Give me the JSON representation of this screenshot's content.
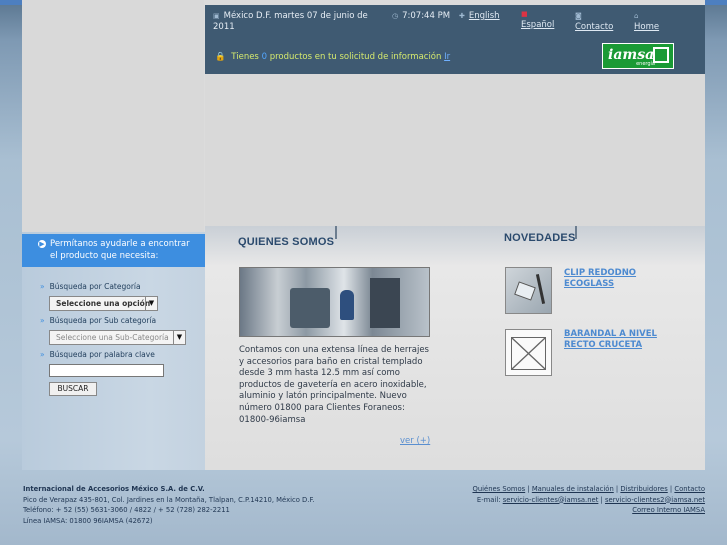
{
  "header": {
    "date": "México D.F. martes 07 de junio de 2011",
    "time": "7:07:44 PM",
    "lang_english": "English",
    "lang_spanish": "Español",
    "contact": "Contacto",
    "home": "Home",
    "cart_prefix": "Tienes",
    "cart_count": "0",
    "cart_suffix": "productos en tu solicitud de información",
    "cart_link": "Ir",
    "logo_text": "iamsa",
    "logo_sub": "energía"
  },
  "sidebar": {
    "help_text": "Permítanos ayudarle a encontrar el producto que necesita:",
    "category_label": "Búsqueda por Categoría",
    "category_select": "Seleccione una opción",
    "subcategory_label": "Búsqueda por Sub categoría",
    "subcategory_select": "Seleccione una Sub-Categoría",
    "keyword_label": "Búsqueda por palabra clave",
    "search_button": "BUSCAR"
  },
  "about": {
    "title": "QUIENES SOMOS",
    "text": "Contamos con una extensa línea de herrajes y accesorios para baño en cristal templado desde 3 mm hasta 12.5 mm así como productos de gavetería en acero inoxidable, aluminio y latón principalmente. Nuevo número 01800 para Clientes Foraneos: 01800-96iamsa",
    "more": "ver (+)"
  },
  "news": {
    "title": "NOVEDADES",
    "items": [
      {
        "label": "CLIP REDODNO ECOGLASS"
      },
      {
        "label": "BARANDAL A NIVEL RECTO CRUCETA"
      }
    ]
  },
  "footer": {
    "company": "Internacional de Accesorios México S.A. de C.V.",
    "address": "Pico de Verapaz 435-801, Col. Jardines en la Montaña, Tlalpan, C.P.14210, México D.F.",
    "phone": "Teléfono: + 52 (55) 5631-3060 / 4822 / + 52 (728) 282-2211",
    "hotline": "Línea IAMSA: 01800 96IAMSA (42672)",
    "links": [
      "Quiénes Somos",
      "Manuales de instalación",
      "Distribuidores",
      "Contacto"
    ],
    "email_label": "E-mail:",
    "email1": "servicio-clientes@iamsa.net",
    "email2": "servicio-clientes2@iamsa.net",
    "mail_link": "Correo Interno IAMSA"
  },
  "colors": {
    "accent_blue": "#3d8ee0",
    "header_bg": "#3f5a72",
    "logo_green": "#1a9a35"
  }
}
